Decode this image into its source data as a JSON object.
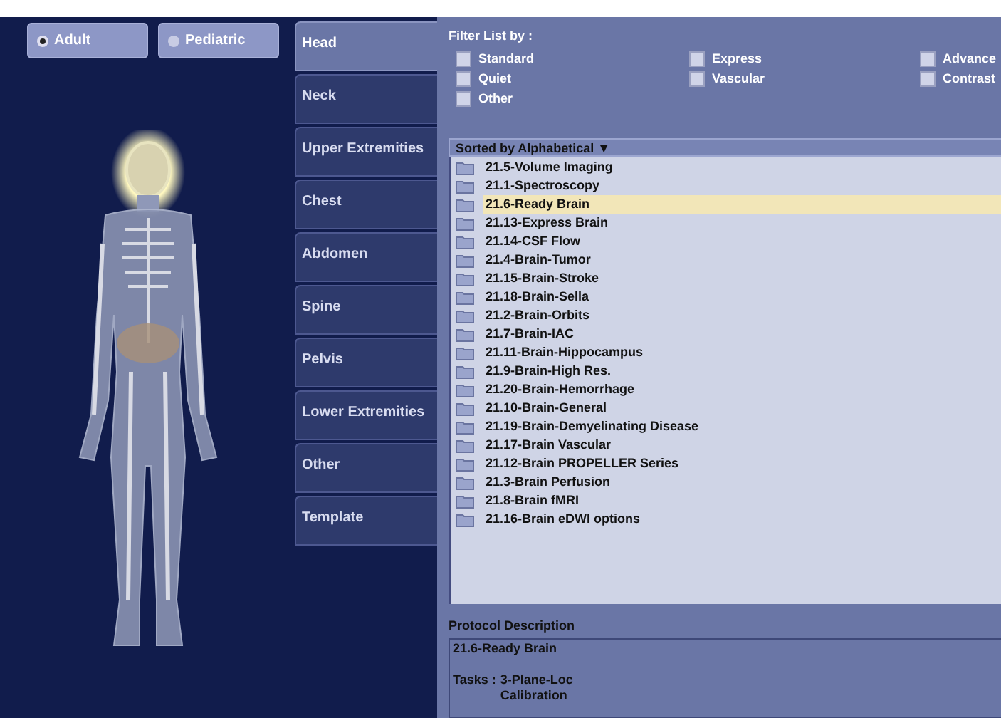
{
  "patient_types": [
    {
      "label": "Adult",
      "selected": true
    },
    {
      "label": "Pediatric",
      "selected": false
    }
  ],
  "tabs": [
    {
      "label": "Head",
      "selected": true
    },
    {
      "label": "Neck",
      "selected": false
    },
    {
      "label": "Upper Extremities",
      "selected": false
    },
    {
      "label": "Chest",
      "selected": false
    },
    {
      "label": "Abdomen",
      "selected": false
    },
    {
      "label": "Spine",
      "selected": false
    },
    {
      "label": "Pelvis",
      "selected": false
    },
    {
      "label": "Lower Extremities",
      "selected": false
    },
    {
      "label": "Other",
      "selected": false
    },
    {
      "label": "Template",
      "selected": false
    }
  ],
  "filter": {
    "label": "Filter List by :",
    "options": [
      {
        "label": "Standard",
        "checked": false
      },
      {
        "label": "Express",
        "checked": false
      },
      {
        "label": "Advance",
        "checked": false
      },
      {
        "label": "Quiet",
        "checked": false
      },
      {
        "label": "Vascular",
        "checked": false
      },
      {
        "label": "Contrast",
        "checked": false
      },
      {
        "label": "Other",
        "checked": false
      }
    ]
  },
  "protocol_list": {
    "sort_header": "Sorted by Alphabetical ▼",
    "items": [
      {
        "label": "21.5-Volume Imaging",
        "selected": false
      },
      {
        "label": "21.1-Spectroscopy",
        "selected": false
      },
      {
        "label": "21.6-Ready Brain",
        "selected": true
      },
      {
        "label": "21.13-Express Brain",
        "selected": false
      },
      {
        "label": "21.14-CSF Flow",
        "selected": false
      },
      {
        "label": "21.4-Brain-Tumor",
        "selected": false
      },
      {
        "label": "21.15-Brain-Stroke",
        "selected": false
      },
      {
        "label": "21.18-Brain-Sella",
        "selected": false
      },
      {
        "label": "21.2-Brain-Orbits",
        "selected": false
      },
      {
        "label": "21.7-Brain-IAC",
        "selected": false
      },
      {
        "label": "21.11-Brain-Hippocampus",
        "selected": false
      },
      {
        "label": "21.9-Brain-High Res.",
        "selected": false
      },
      {
        "label": "21.20-Brain-Hemorrhage",
        "selected": false
      },
      {
        "label": "21.10-Brain-General",
        "selected": false
      },
      {
        "label": "21.19-Brain-Demyelinating Disease",
        "selected": false
      },
      {
        "label": "21.17-Brain Vascular",
        "selected": false
      },
      {
        "label": "21.12-Brain PROPELLER Series",
        "selected": false
      },
      {
        "label": "21.3-Brain Perfusion",
        "selected": false
      },
      {
        "label": "21.8-Brain fMRI",
        "selected": false
      },
      {
        "label": "21.16-Brain eDWI options",
        "selected": false
      }
    ]
  },
  "description": {
    "label": "Protocol Description",
    "title": "21.6-Ready Brain",
    "tasks_label": "Tasks :",
    "tasks": [
      "3-Plane-Loc",
      "Calibration"
    ]
  }
}
